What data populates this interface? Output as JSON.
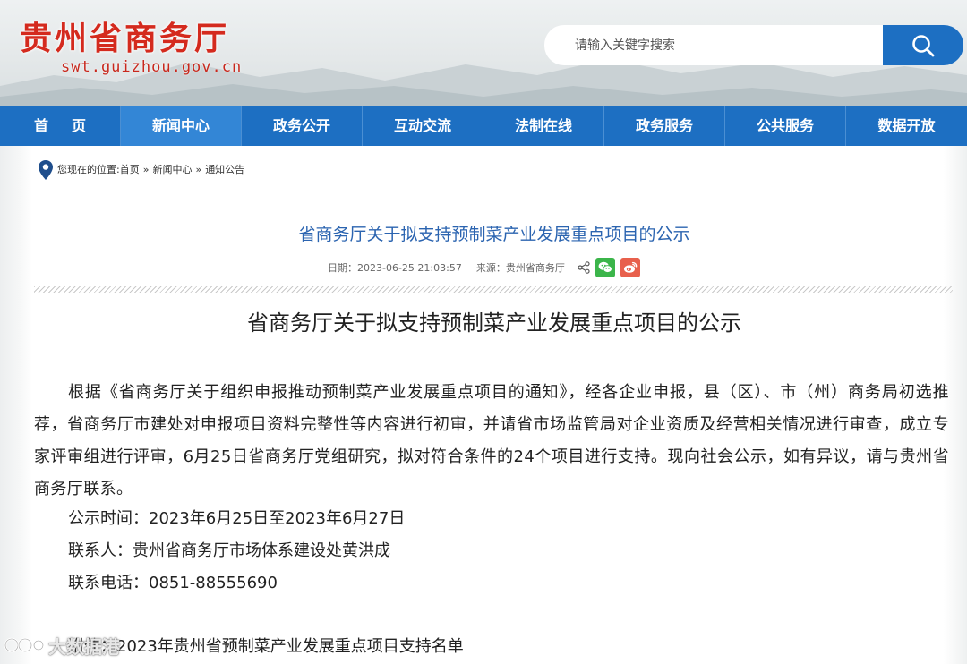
{
  "header": {
    "site_title": "贵州省商务厅",
    "site_domain": "swt.guizhou.gov.cn",
    "search_placeholder": "请输入关键字搜索",
    "search_icon": "search-icon",
    "colors": {
      "title_red": "#d42a1e",
      "brand_blue": "#1d6fc2"
    }
  },
  "nav": {
    "items": [
      {
        "label": "首页",
        "active": false
      },
      {
        "label": "新闻中心",
        "active": true
      },
      {
        "label": "政务公开",
        "active": false
      },
      {
        "label": "互动交流",
        "active": false
      },
      {
        "label": "法制在线",
        "active": false
      },
      {
        "label": "政务服务",
        "active": false
      },
      {
        "label": "公共服务",
        "active": false
      },
      {
        "label": "数据开放",
        "active": false
      }
    ]
  },
  "breadcrumb": {
    "icon": "location-pin-icon",
    "prefix": "您现在的位置:",
    "items": [
      "首页",
      "新闻中心",
      "通知公告"
    ],
    "separator": "»"
  },
  "article": {
    "title": "省商务厅关于拟支持预制菜产业发展重点项目的公示",
    "date_label": "日期：2023-06-25 21:03:57",
    "source_label": "来源：贵州省商务厅",
    "share_icons": [
      "share-icon",
      "wechat-icon",
      "weibo-icon"
    ],
    "content_title": "省商务厅关于拟支持预制菜产业发展重点项目的公示",
    "paragraph": "根据《省商务厅关于组织申报推动预制菜产业发展重点项目的通知》，经各企业申报，县（区）、市（州）商务局初选推荐，省商务厅市建处对申报项目资料完整性等内容进行初审，并请省市场监管局对企业资质及经营相关情况进行审查，成立专家评审组进行评审，6月25日省商务厅党组研究，拟对符合条件的24个项目进行支持。现向社会公示，如有异议，请与贵州省商务厅联系。",
    "publicity_time": "公示时间：2023年6月25日至2023年6月27日",
    "contact_person": "联系人：贵州省商务厅市场体系建设处黄洪成",
    "contact_phone": "联系电话：0851-88555690",
    "attachment": "附件：2023年贵州省预制菜产业发展重点项目支持名单"
  },
  "watermark": {
    "text": "大数据港",
    "icon": "watermark-logo-icon"
  }
}
